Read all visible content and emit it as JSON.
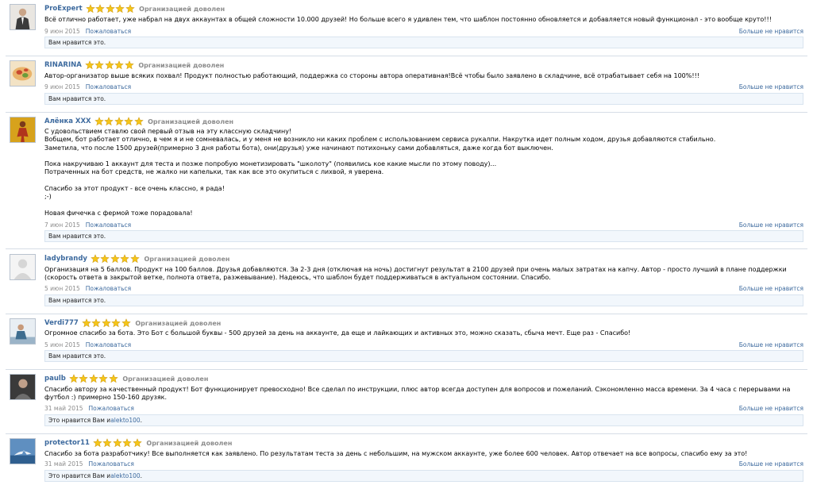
{
  "theme": {
    "link_color": "#3d6a9e",
    "star_color": "#f5c518",
    "status_color": "#8c8c8c",
    "likes_bg": "#f2f7fc"
  },
  "status_text": "Организацией доволен",
  "report_label": "Пожаловаться",
  "unlike_label": "Больше не нравится",
  "reviews": [
    {
      "username": "ProExpert",
      "rating": 5,
      "avatar_icon": "man-in-suit-avatar",
      "text": "Всё отлично работает, уже набрал на двух аккаунтах в общей сложности 10.000 друзей! Но больше всего я удивлен тем, что шаблон постоянно обновляется и добавляется новый функционал - это вообще круто!!!",
      "date": "9 июн 2015",
      "likes_text": "Вам нравится это."
    },
    {
      "username": "RINARINA",
      "rating": 5,
      "avatar_icon": "food-photo-avatar",
      "text": "Автор-организатор выше всяких похвал! Продукт полностью работающий, поддержка со стороны автора оперативная!Всё чтобы было заявлено в складчине, всё отрабатывает себя на 100%!!!",
      "date": "9 июн 2015",
      "likes_text": "Вам нравится это."
    },
    {
      "username": "Алёнка ХХХ",
      "rating": 5,
      "avatar_icon": "woman-figure-avatar",
      "text": "С удовольствием ставлю свой первый отзыв на эту классную складчину!\nВобщем, бот работает отлично, в чем я и не сомневалась, и у меня не возникло ни каких проблем с использованием сервиса рукалпи. Накрутка идет полным ходом, друзья добавляются стабильно.\nЗаметила, что после 1500 друзей(примерно 3 дня работы бота), они(друзья) уже начинают потихоньку сами добавляться, даже когда бот выключен.\n\nПока накручиваю 1 аккаунт для теста и позже попробую монетизировать \"школоту\" (появились кое какие мысли по этому поводу)...\nПотраченных на бот средств, не жалко ни капельки, так как все это окупиться с лихвой, я уверена.\n\nСпасибо за этот продукт - все очень классно, я рада!\n;-)\n\nНовая фичечка с фермой тоже порадовала!",
      "date": "7 июн 2015",
      "likes_text": "Вам нравится это."
    },
    {
      "username": "ladybrandy",
      "rating": 5,
      "avatar_icon": "default-user-avatar",
      "text": "Организация на 5 баллов. Продукт на 100 баллов. Друзья добавляются. За 2-3 дня (отключая на ночь) достигнут результат в 2100 друзей при очень малых затратах на капчу. Автор - просто лучший в плане поддержки (скорость ответа в закрытой ветке, полнота ответа, разжевывание). Надеюсь, что шаблон будет поддерживаться в актуальном состоянии. Спасибо.",
      "date": "5 июн 2015",
      "likes_text": "Вам нравится это."
    },
    {
      "username": "Verdi777",
      "rating": 5,
      "avatar_icon": "person-sitting-avatar",
      "text": "Огромное спасибо за бота. Это Бот с большой буквы - 500 друзей за день на аккаунте, да еще и лайкающих и активных это, можно сказать, сбыча мечт. Еще раз - Спасибо!",
      "date": "5 июн 2015",
      "likes_text": "Вам нравится это."
    },
    {
      "username": "paulb",
      "rating": 5,
      "avatar_icon": "man-portrait-avatar",
      "text": "Спасибо автору за качественный продукт! Бот функционирует превосходно! Все сделал по инструкции, плюс автор всегда доступен для вопросов и пожеланий. Сэкономленно масса времени. За 4 часа с перерывами на футбол :) примерно 150-160 друзяк.",
      "date": "31 май 2015",
      "likes_prefix": "Это нравится Вам и ",
      "likes_user": "alekto100",
      "likes_suffix": "."
    },
    {
      "username": "protector11",
      "rating": 5,
      "avatar_icon": "shark-photo-avatar",
      "text": "Спасибо за бота разработчику! Все выполняется как заявлено. По результатам теста за день с небольшим, на мужском аккаунте, уже более 600 человек. Автор отвечает на все вопросы, спасибо ему за это!",
      "date": "31 май 2015",
      "likes_prefix": "Это нравится Вам и ",
      "likes_user": "alekto100",
      "likes_suffix": "."
    }
  ]
}
